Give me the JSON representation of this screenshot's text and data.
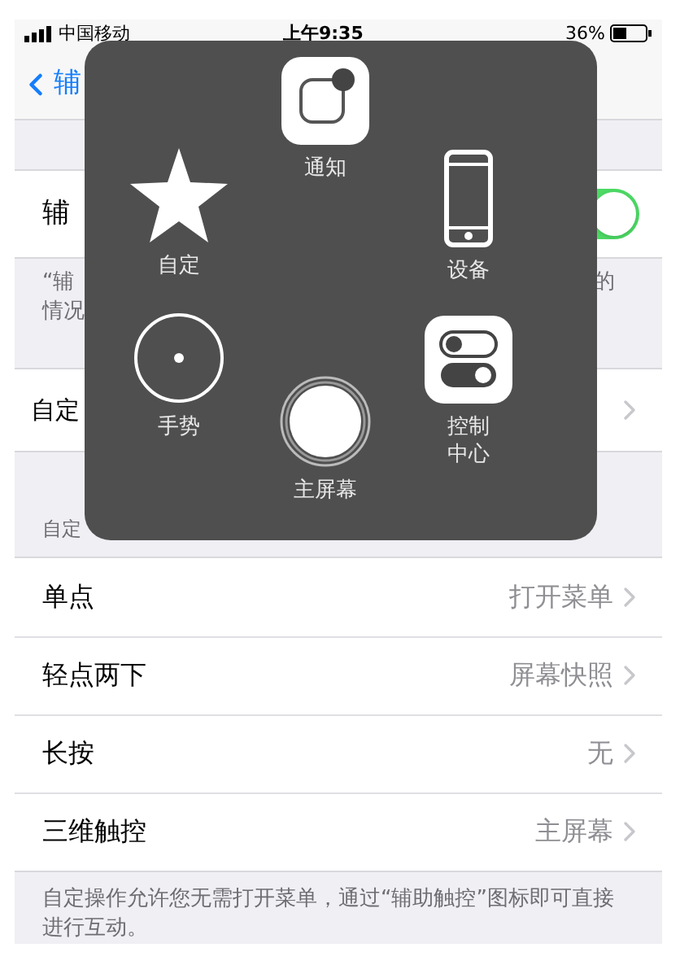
{
  "status_bar": {
    "carrier": "中国移动",
    "time": "上午9:35",
    "battery": "36%"
  },
  "nav": {
    "back_label": "辅"
  },
  "toggle_row": {
    "label": "辅",
    "on": true
  },
  "toggle_footer": {
    "line_1_left": "“辅",
    "line_1_right": "的",
    "line_2": "情况"
  },
  "custom_row": {
    "label": "自定"
  },
  "section_header": "自定",
  "actions": [
    {
      "label": "单点",
      "value": "打开菜单"
    },
    {
      "label": "轻点两下",
      "value": "屏幕快照"
    },
    {
      "label": "长按",
      "value": "无"
    },
    {
      "label": "三维触控",
      "value": "主屏幕"
    }
  ],
  "actions_footer": "自定操作允许您无需打开菜单，通过“辅助触控”图标即可直接进行互动。",
  "menu": [
    {
      "kind": "notification",
      "label": "通知"
    },
    {
      "kind": "custom",
      "label": "自定"
    },
    {
      "kind": "device",
      "label": "设备"
    },
    {
      "kind": "gesture",
      "label": "手势"
    },
    {
      "kind": "home",
      "label": "主屏幕"
    },
    {
      "kind": "control",
      "label": "控制中心"
    }
  ]
}
